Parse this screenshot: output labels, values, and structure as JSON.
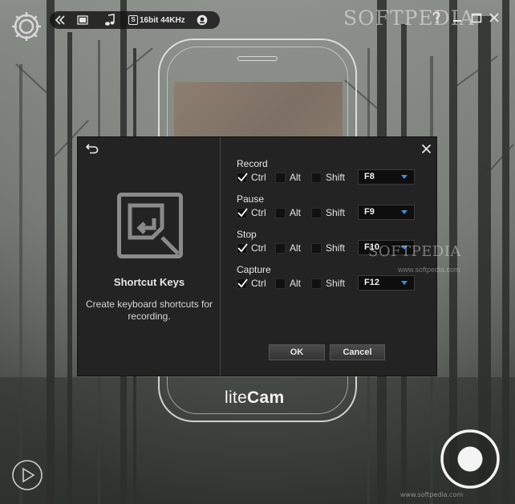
{
  "toolbar": {
    "audio_label": "16bit 44KHz",
    "audio_badge": "S"
  },
  "watermark": {
    "brand": "SOFTPEDIA",
    "brand_mid": "SOFTPEDIA",
    "url_mid": "www.softpedia.com",
    "url_bottom": "www.softpedia.com"
  },
  "app": {
    "brand_light": "lite",
    "brand_bold": "Cam"
  },
  "dialog": {
    "title": "Shortcut Keys",
    "description": "Create keyboard shortcuts for recording.",
    "shortcuts": [
      {
        "label": "Record",
        "ctrl": true,
        "alt": false,
        "shift": false,
        "key": "F8"
      },
      {
        "label": "Pause",
        "ctrl": true,
        "alt": false,
        "shift": false,
        "key": "F9"
      },
      {
        "label": "Stop",
        "ctrl": true,
        "alt": false,
        "shift": false,
        "key": "F10"
      },
      {
        "label": "Capture",
        "ctrl": true,
        "alt": false,
        "shift": false,
        "key": "F12"
      }
    ],
    "modifier_labels": {
      "ctrl": "Ctrl",
      "alt": "Alt",
      "shift": "Shift"
    },
    "ok_label": "OK",
    "cancel_label": "Cancel"
  },
  "colors": {
    "accent": "#3d8fd6",
    "dialog_bg": "#232323",
    "frame": "#ebebeb"
  }
}
